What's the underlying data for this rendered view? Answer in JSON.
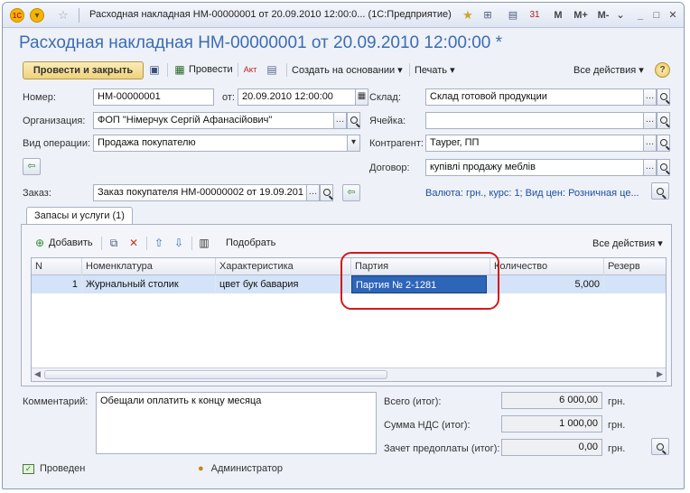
{
  "window": {
    "title": "Расходная накладная НМ-00000001 от 20.09.2010 12:00:0... (1С:Предприятие)",
    "tb_buttons": [
      "M",
      "M+",
      "M-"
    ]
  },
  "document": {
    "heading": "Расходная накладная НМ-00000001 от 20.09.2010 12:00:00",
    "modified_mark": "*"
  },
  "toolbar": {
    "post_close": "Провести и закрыть",
    "post": "Провести",
    "create_based": "Создать на основании",
    "print": "Печать",
    "all_actions": "Все действия",
    "help": "?"
  },
  "form": {
    "number_label": "Номер:",
    "number_value": "НМ-00000001",
    "date_label": "от:",
    "date_value": "20.09.2010 12:00:00",
    "org_label": "Организация:",
    "org_value": "ФОП \"Німерчук Сергій Афанасійович\"",
    "op_label": "Вид операции:",
    "op_value": "Продажа покупателю",
    "warehouse_label": "Склад:",
    "warehouse_value": "Склад готовой продукции",
    "cell_label": "Ячейка:",
    "cell_value": "",
    "contractor_label": "Контрагент:",
    "contractor_value": "Таурег, ПП",
    "contract_label": "Договор:",
    "contract_value": "купівлі продажу меблів",
    "order_label": "Заказ:",
    "order_value": "Заказ покупателя НМ-00000002 от 19.09.201",
    "currency_info": "Валюта: грн., курс: 1; Вид цен: Розничная це..."
  },
  "tabs": [
    {
      "label": "Запасы и услуги (1)"
    }
  ],
  "goods": {
    "add_label": "Добавить",
    "pick_label": "Подобрать",
    "all_actions": "Все действия",
    "columns": [
      "N",
      "Номенклатура",
      "Характеристика",
      "Партия",
      "Количество",
      "Резерв"
    ],
    "rows": [
      {
        "n": "1",
        "item": "Журнальный столик",
        "characteristic": "цвет бук бавария",
        "batch": "Партия № 2-1281",
        "quantity": "5,000",
        "reserve": ""
      }
    ]
  },
  "footer": {
    "comment_label": "Комментарий:",
    "comment_value": "Обещали оплатить к концу месяца",
    "total_label": "Всего (итог):",
    "total_value": "6 000,00",
    "vat_label": "Сумма НДС (итог):",
    "vat_value": "1 000,00",
    "prepay_label": "Зачет предоплаты (итог):",
    "prepay_value": "0,00",
    "currency": "грн.",
    "status_posted": "Проведен",
    "user": "Администратор"
  },
  "colors": {
    "title_blue": "#3b6db2",
    "selected_cell": "#2d66b8",
    "annotation_red": "#d21a1a",
    "button_gold": "#efd27a"
  }
}
